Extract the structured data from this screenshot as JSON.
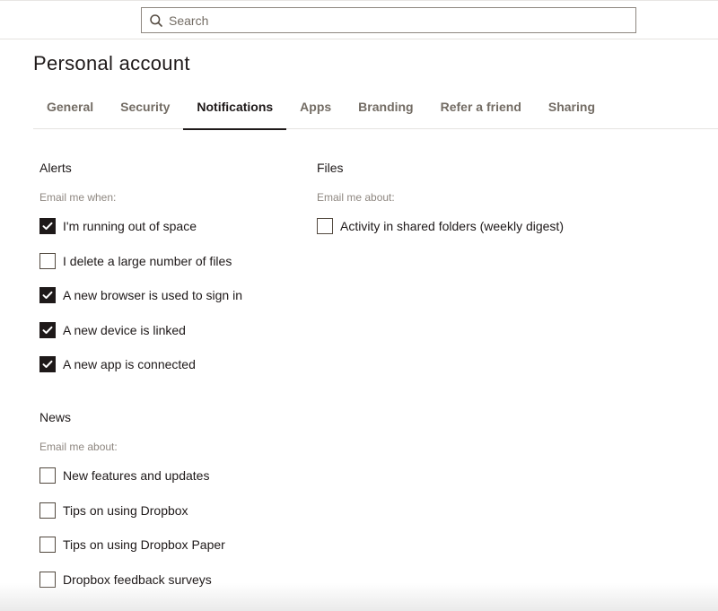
{
  "search": {
    "placeholder": "Search",
    "value": ""
  },
  "page": {
    "title": "Personal account"
  },
  "tabs": [
    {
      "label": "General",
      "active": false
    },
    {
      "label": "Security",
      "active": false
    },
    {
      "label": "Notifications",
      "active": true
    },
    {
      "label": "Apps",
      "active": false
    },
    {
      "label": "Branding",
      "active": false
    },
    {
      "label": "Refer a friend",
      "active": false
    },
    {
      "label": "Sharing",
      "active": false
    }
  ],
  "alerts": {
    "title": "Alerts",
    "subtitle": "Email me when:",
    "options": [
      {
        "label": "I'm running out of space",
        "checked": true
      },
      {
        "label": "I delete a large number of files",
        "checked": false
      },
      {
        "label": "A new browser is used to sign in",
        "checked": true
      },
      {
        "label": "A new device is linked",
        "checked": true
      },
      {
        "label": "A new app is connected",
        "checked": true
      }
    ]
  },
  "news": {
    "title": "News",
    "subtitle": "Email me about:",
    "options": [
      {
        "label": "New features and updates",
        "checked": false
      },
      {
        "label": "Tips on using Dropbox",
        "checked": false
      },
      {
        "label": "Tips on using Dropbox Paper",
        "checked": false
      },
      {
        "label": "Dropbox feedback surveys",
        "checked": false
      }
    ]
  },
  "files": {
    "title": "Files",
    "subtitle": "Email me about:",
    "options": [
      {
        "label": "Activity in shared folders (weekly digest)",
        "checked": false
      }
    ]
  },
  "icons": {
    "search": "search-icon",
    "check": "checkmark-icon"
  },
  "colors": {
    "text": "#1e1919",
    "muted": "#736c64",
    "accent": "#1e1919"
  }
}
